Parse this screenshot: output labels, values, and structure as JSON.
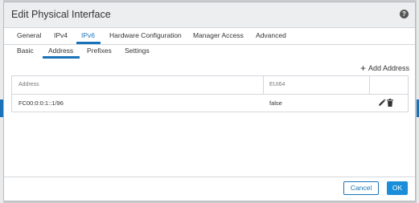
{
  "dialog": {
    "title": "Edit Physical Interface",
    "help_icon": "?"
  },
  "tabs_primary": [
    {
      "label": "General"
    },
    {
      "label": "IPv4"
    },
    {
      "label": "IPv6",
      "active": true
    },
    {
      "label": "Hardware Configuration"
    },
    {
      "label": "Manager Access"
    },
    {
      "label": "Advanced"
    }
  ],
  "tabs_secondary": [
    {
      "label": "Basic"
    },
    {
      "label": "Address",
      "active": true
    },
    {
      "label": "Prefixes"
    },
    {
      "label": "Settings"
    }
  ],
  "actions": {
    "add_address": "Add Address"
  },
  "table": {
    "columns": [
      "Address",
      "EUI64",
      ""
    ],
    "rows": [
      {
        "address": "FC00:0:0:1::1/96",
        "eui64": "false"
      }
    ]
  },
  "footer": {
    "cancel": "Cancel",
    "ok": "OK"
  },
  "colors": {
    "accent": "#1a73b8",
    "primary_button": "#1a8ed8"
  }
}
